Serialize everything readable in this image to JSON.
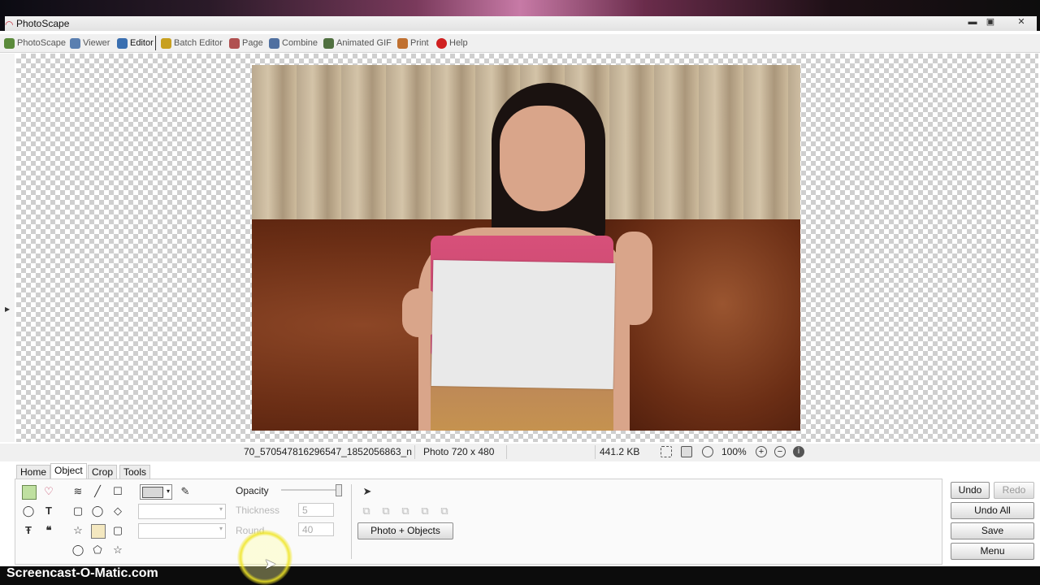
{
  "window": {
    "title": "PhotoScape",
    "min": "▬",
    "max": "▣",
    "close": "✕"
  },
  "menu": [
    {
      "label": "PhotoScape",
      "color": "#5a8a3a"
    },
    {
      "label": "Viewer",
      "color": "#5a7fb0"
    },
    {
      "label": "Editor",
      "color": "#3a6fb0"
    },
    {
      "label": "Batch Editor",
      "color": "#c8a020"
    },
    {
      "label": "Page",
      "color": "#b05050"
    },
    {
      "label": "Combine",
      "color": "#5070a0"
    },
    {
      "label": "Animated GIF",
      "color": "#507040"
    },
    {
      "label": "Print",
      "color": "#c07030"
    },
    {
      "label": "Help",
      "color": "#d02020"
    }
  ],
  "status": {
    "filename": "70_570547816296547_1852056863_n",
    "photo_info": "Photo 720 x 480",
    "filesize": "441.2 KB",
    "zoom": "100%",
    "icons": [
      "fit-icon",
      "actual-size-icon",
      "zoom-fit-icon",
      "zoom-in-icon",
      "zoom-out-icon",
      "info-icon"
    ]
  },
  "panel": {
    "tabs": [
      "Home",
      "Object",
      "Crop",
      "Tools"
    ],
    "active_tab": "Object",
    "opacity_label": "Opacity",
    "opacity_value_fraction": 1.0,
    "thickness_label": "Thickness",
    "thickness_value": "5",
    "round_label": "Round",
    "round_value": "40",
    "photo_objects_button": "Photo + Objects"
  },
  "actions": {
    "undo": "Undo",
    "redo": "Redo",
    "undo_all": "Undo All",
    "save": "Save",
    "menu": "Menu"
  },
  "watermark": "Screencast-O-Matic.com"
}
